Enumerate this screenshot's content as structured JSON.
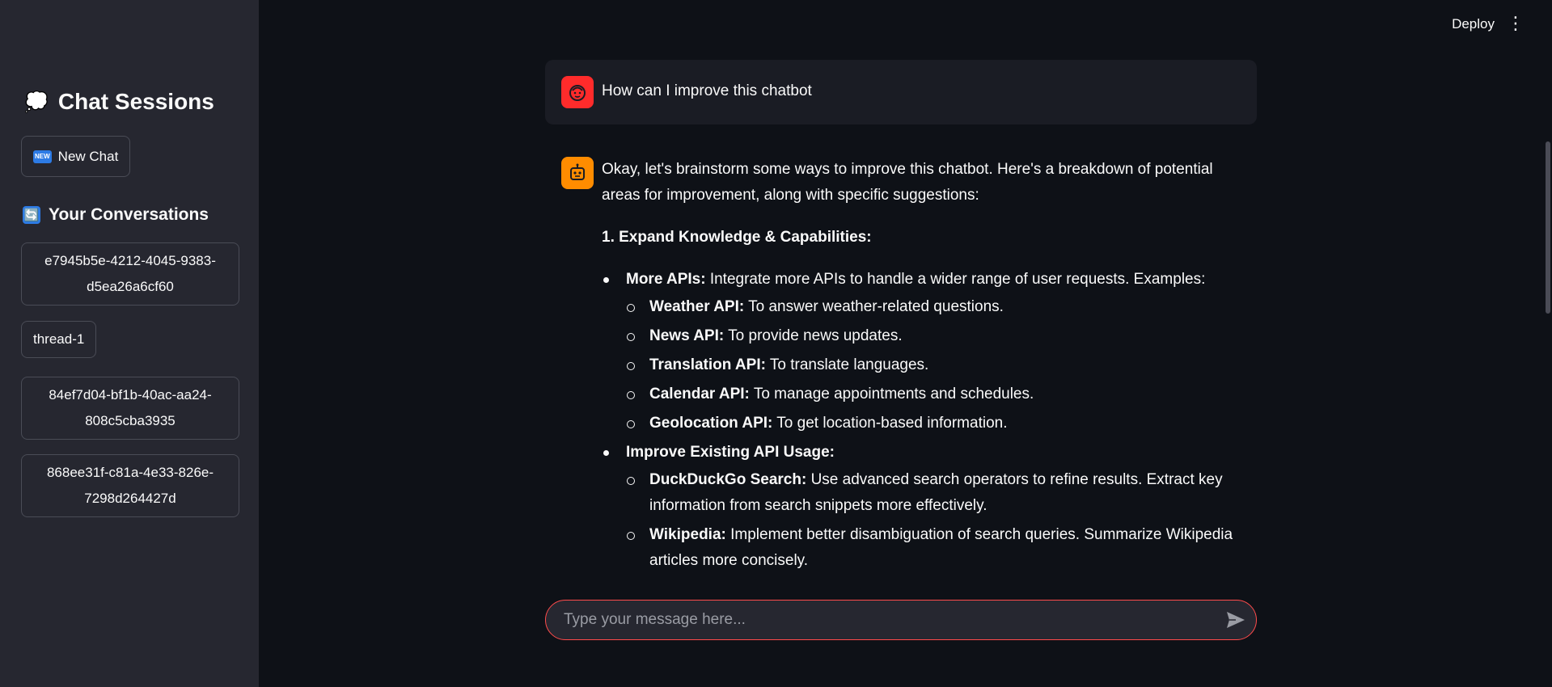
{
  "sidebar": {
    "title_emoji": "💭",
    "title": "Chat Sessions",
    "new_chat_badge": "NEW",
    "new_chat_label": "New Chat",
    "conversations_icon": "🔄",
    "conversations_title": "Your Conversations",
    "conversations": [
      {
        "line1": "e7945b5e-4212-4045-9383-",
        "line2": "d5ea26a6cf60"
      },
      {
        "line1": "thread-1",
        "line2": ""
      },
      {
        "line1": "84ef7d04-bf1b-40ac-aa24-",
        "line2": "808c5cba3935"
      },
      {
        "line1": "868ee31f-c81a-4e33-826e-",
        "line2": "7298d264427d"
      }
    ]
  },
  "header": {
    "deploy_label": "Deploy",
    "menu_icon": "⋮"
  },
  "chat": {
    "user_message": "How can I improve this chatbot",
    "assistant": {
      "intro": "Okay, let's brainstorm some ways to improve this chatbot. Here's a breakdown of potential areas for improvement, along with specific suggestions:",
      "section_heading": "1. Expand Knowledge & Capabilities:",
      "bullets": [
        {
          "bold": "More APIs:",
          "text": " Integrate more APIs to handle a wider range of user requests. Examples:",
          "sub": [
            {
              "bold": "Weather API:",
              "text": " To answer weather-related questions."
            },
            {
              "bold": "News API:",
              "text": " To provide news updates."
            },
            {
              "bold": "Translation API:",
              "text": " To translate languages."
            },
            {
              "bold": "Calendar API:",
              "text": " To manage appointments and schedules."
            },
            {
              "bold": "Geolocation API:",
              "text": " To get location-based information."
            }
          ]
        },
        {
          "bold": "Improve Existing API Usage:",
          "text": "",
          "sub": [
            {
              "bold": "DuckDuckGo Search:",
              "text": " Use advanced search operators to refine results. Extract key information from search snippets more effectively."
            },
            {
              "bold": "Wikipedia:",
              "text": " Implement better disambiguation of search queries. Summarize Wikipedia articles more concisely."
            }
          ]
        }
      ]
    },
    "input_placeholder": "Type your message here...",
    "input_value": ""
  },
  "colors": {
    "accent": "#ff4b4b",
    "user_avatar": "#ff2b2b",
    "bot_avatar": "#ff8c00",
    "sidebar_bg": "#262730",
    "main_bg": "#0e1117"
  }
}
